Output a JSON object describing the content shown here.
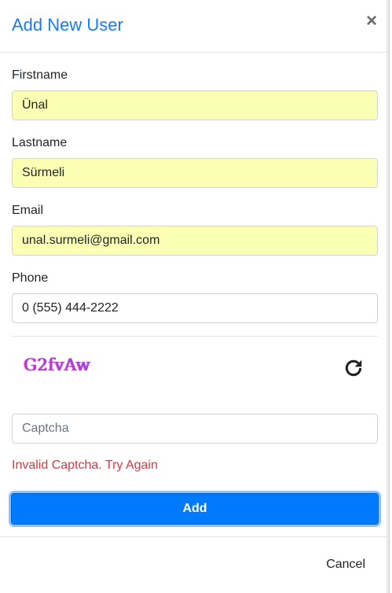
{
  "modal": {
    "title": "Add New User",
    "close_symbol": "×"
  },
  "form": {
    "firstname": {
      "label": "Firstname",
      "value": "Ünal"
    },
    "lastname": {
      "label": "Lastname",
      "value": "Sürmeli"
    },
    "email": {
      "label": "Email",
      "value": "unal.surmeli@gmail.com"
    },
    "phone": {
      "label": "Phone",
      "value": "0 (555) 444-2222"
    },
    "captcha": {
      "image_text": "G2fvAw",
      "refresh_icon": "refresh-icon",
      "placeholder": "Captcha",
      "error": "Invalid Captcha. Try Again"
    }
  },
  "actions": {
    "add_label": "Add",
    "cancel_label": "Cancel"
  },
  "colors": {
    "title": "#1a7bf5",
    "autofill_bg": "#fbffb4",
    "primary": "#007bff",
    "error": "#dc3545"
  }
}
